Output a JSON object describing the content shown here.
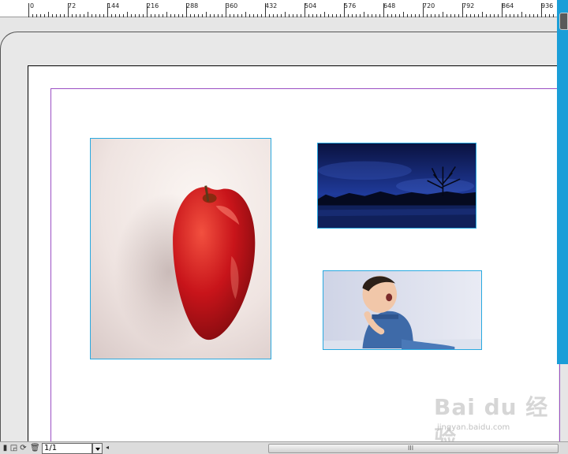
{
  "ruler": {
    "labels": [
      "0",
      "72",
      "144",
      "216",
      "288",
      "360",
      "432",
      "504",
      "576",
      "648",
      "720",
      "792",
      "864",
      "936"
    ]
  },
  "images": {
    "apple": {
      "icon": "apple-photo"
    },
    "night": {
      "icon": "night-landscape-photo"
    },
    "baby": {
      "icon": "baby-photo"
    }
  },
  "pagination": {
    "current": "1/1"
  },
  "scrollbar": {
    "grip": "III"
  },
  "watermark": {
    "logo": "Bai du 经验",
    "url": "jingyan.baidu.com"
  },
  "colors": {
    "frame_border": "#29a9e0",
    "margin_guide": "#9b4fc4",
    "side_panel": "#1a9ed8"
  }
}
